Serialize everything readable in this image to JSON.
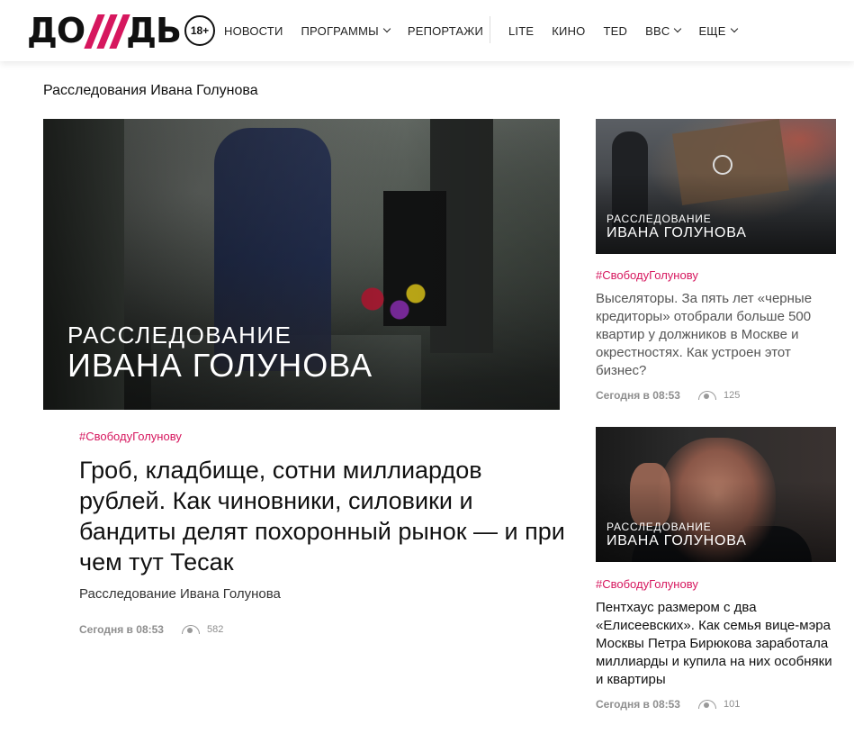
{
  "header": {
    "logo_text_left": "ДО",
    "logo_text_right": "ДЬ",
    "age_badge": "18+",
    "nav_left": [
      {
        "label": "НОВОСТИ",
        "dropdown": false
      },
      {
        "label": "ПРОГРАММЫ",
        "dropdown": true
      },
      {
        "label": "РЕПОРТАЖИ",
        "dropdown": false
      }
    ],
    "nav_right": [
      {
        "label": "LITE",
        "dropdown": false
      },
      {
        "label": "КИНО",
        "dropdown": false
      },
      {
        "label": "TED",
        "dropdown": false
      },
      {
        "label": "BBC",
        "dropdown": true
      },
      {
        "label": "ЕЩЕ",
        "dropdown": true
      }
    ]
  },
  "section_title": "Расследования Ивана Голунова",
  "main": {
    "image_caption_line1": "РАССЛЕДОВАНИЕ",
    "image_caption_line2": "ИВАНА ГОЛУНОВА",
    "tag": "#СвободуГолунову",
    "title": "Гроб, кладбище, сотни миллиардов рублей. Как чиновники, силовики и бандиты делят похоронный рынок — и при чем тут Тесак",
    "subtitle": "Расследование Ивана Голунова",
    "date": "Сегодня в 08:53",
    "views": "582"
  },
  "side": [
    {
      "image_caption_line1": "РАССЛЕДОВАНИЕ",
      "image_caption_line2": "ИВАНА ГОЛУНОВА",
      "tag": "#СвободуГолунову",
      "title": "Выселяторы. За пять лет «черные кредиторы» отобрали больше 500 квартир у должников в Москве и окрестностях. Как устроен этот бизнес?",
      "date": "Сегодня в 08:53",
      "views": "125"
    },
    {
      "image_caption_line1": "РАССЛЕДОВАНИЕ",
      "image_caption_line2": "ИВАНА ГОЛУНОВА",
      "tag": "#СвободуГолунову",
      "title": "Пентхаус размером с два «Елисеевских». Как семья вице-мэра Москвы Петра Бирюкова заработала миллиарды и купила на них особняки и квартиры",
      "date": "Сегодня в 08:53",
      "views": "101"
    }
  ],
  "colors": {
    "accent": "#d6175e",
    "meta_gray": "#8e8e8e"
  },
  "icons": [
    "eye-icon",
    "chevron-down-icon"
  ]
}
